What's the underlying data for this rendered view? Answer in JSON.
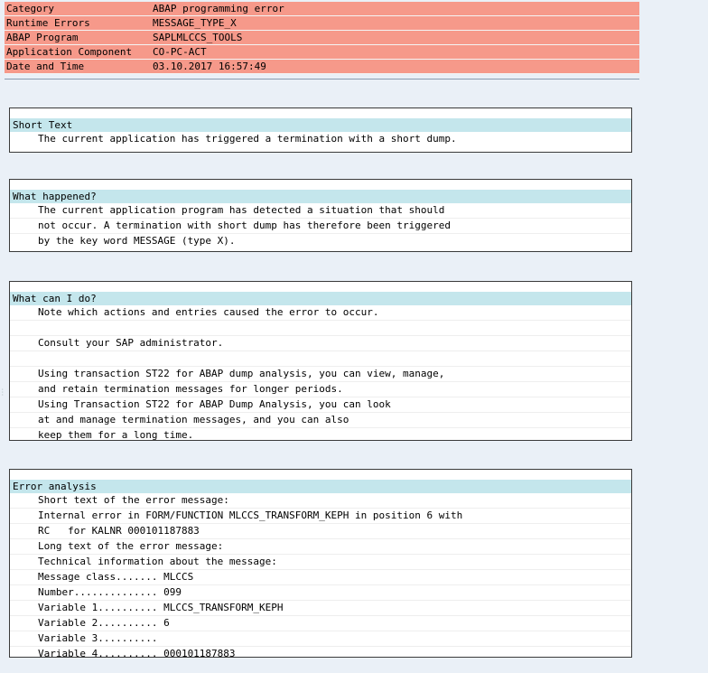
{
  "header": {
    "rows": [
      {
        "label": "Category",
        "value": "ABAP programming error"
      },
      {
        "label": "Runtime Errors",
        "value": "MESSAGE_TYPE_X"
      },
      {
        "label": "ABAP Program",
        "value": "SAPLMLCCS_TOOLS"
      },
      {
        "label": "Application Component",
        "value": "CO-PC-ACT"
      },
      {
        "label": "Date and Time",
        "value": "03.10.2017 16:57:49"
      }
    ]
  },
  "sections": {
    "short_text": {
      "title": "Short Text",
      "lines": [
        "The current application has triggered a termination with a short dump."
      ]
    },
    "what_happened": {
      "title": "What happened?",
      "lines": [
        "The current application program has detected a situation that should",
        "not occur. A termination with short dump has therefore been triggered",
        "by the key word MESSAGE (type X)."
      ]
    },
    "what_can_i_do": {
      "title": "What can I do?",
      "lines": [
        "Note which actions and entries caused the error to occur.",
        "",
        "Consult your SAP administrator.",
        "",
        "Using transaction ST22 for ABAP dump analysis, you can view, manage,",
        "and retain termination messages for longer periods.",
        "Using Transaction ST22 for ABAP Dump Analysis, you can look",
        "at and manage termination messages, and you can also",
        "keep them for a long time."
      ]
    },
    "error_analysis": {
      "title": "Error analysis",
      "lines": [
        "Short text of the error message:",
        "Internal error in FORM/FUNCTION MLCCS_TRANSFORM_KEPH in position 6 with",
        "RC   for KALNR 000101187883",
        "Long text of the error message:",
        "Technical information about the message:",
        "Message class....... MLCCS",
        "Number.............. 099",
        "Variable 1.......... MLCCS_TRANSFORM_KEPH",
        "Variable 2.......... 6",
        "Variable 3..........",
        "Variable 4.......... 000101187883"
      ]
    }
  }
}
